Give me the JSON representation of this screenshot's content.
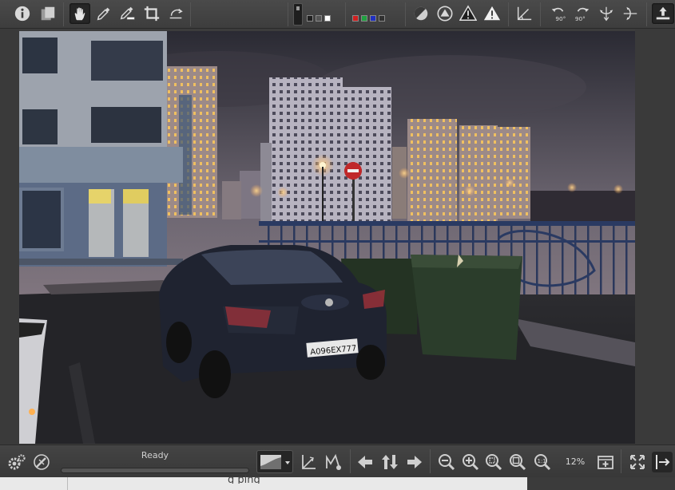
{
  "status": {
    "text": "Ready",
    "progress": 0
  },
  "zoom": {
    "level": "12%"
  },
  "photo": {
    "plate_text": "А096ЕХ777"
  },
  "under_window": {
    "text": "g                      ping"
  },
  "colors": {
    "toolbar_bg": "#3f3f3f",
    "swatch_row1": [
      "#202020",
      "#555555",
      "#ffffff"
    ],
    "swatch_row2": [
      "#d02020",
      "#20a040",
      "#2030c0",
      "#303030"
    ]
  },
  "top_toolbar": {
    "icons": [
      "info-icon",
      "compare-icon",
      "hand-tool-icon",
      "color-picker-icon",
      "white-balance-picker-icon",
      "crop-icon",
      "straighten-icon",
      "indicator-tall-icon",
      "clipping-shadows-icon",
      "clipping-highlights-icon",
      "warning-shadow-icon",
      "warning-highlight-icon",
      "perspective-icon",
      "rotate-left-icon",
      "rotate-right-icon",
      "flip-vertical-icon",
      "flip-horizontal-icon",
      "export-icon"
    ]
  },
  "bottom_toolbar": {
    "icons": [
      "preferences-icon",
      "tools-icon",
      "curve-icon",
      "crop-edge-icon",
      "distortion-icon",
      "previous-image-icon",
      "up-down-icon",
      "next-image-icon",
      "zoom-out-icon",
      "zoom-in-icon",
      "zoom-fit-icon",
      "zoom-fill-icon",
      "zoom-100-icon",
      "new-window-icon",
      "fullscreen-icon",
      "panel-toggle-icon"
    ]
  }
}
